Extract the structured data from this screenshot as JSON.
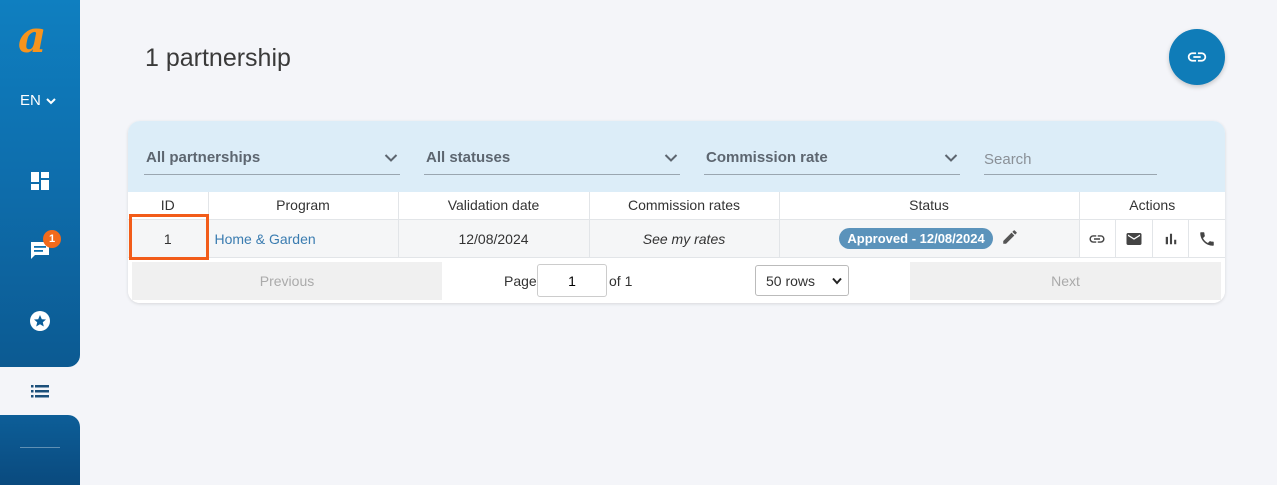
{
  "sidebar": {
    "language": "EN",
    "messages_badge": "1"
  },
  "header": {
    "title": "1 partnership"
  },
  "filters": {
    "partnerships": "All partnerships",
    "statuses": "All statuses",
    "commission": "Commission rate",
    "search_placeholder": "Search"
  },
  "table": {
    "columns": [
      "ID",
      "Program",
      "Validation date",
      "Commission rates",
      "Status",
      "Actions"
    ],
    "rows": [
      {
        "id": "1",
        "program": "Home & Garden",
        "validation_date": "12/08/2024",
        "commission": "See my rates",
        "status": "Approved - 12/08/2024"
      }
    ]
  },
  "pager": {
    "previous": "Previous",
    "page_label": "Page",
    "page_value": "1",
    "of_label": "of 1",
    "rows": "50 rows",
    "next": "Next"
  },
  "colors": {
    "accent": "#0f7cb8",
    "status": "#5b93bb",
    "highlight": "#f25c19",
    "logo": "#f7941d"
  }
}
